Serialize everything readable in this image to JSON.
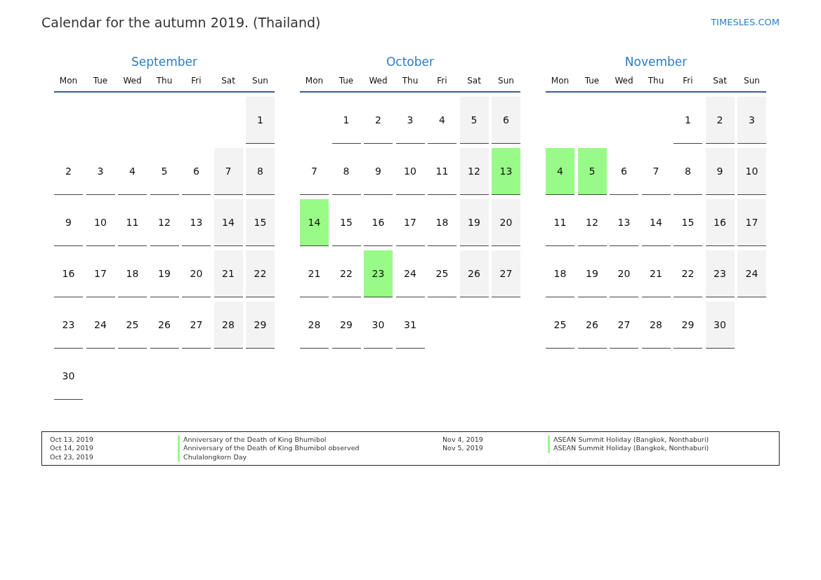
{
  "title": "Calendar for the autumn 2019. (Thailand)",
  "site": "TIMESLES.COM",
  "months": [
    {
      "name": "September",
      "weekdays": [
        "Mon",
        "Tue",
        "Wed",
        "Thu",
        "Fri",
        "Sat",
        "Sun"
      ],
      "weeks": [
        {
          "kind": "start",
          "days": [
            {
              "day": "1",
              "kind": "weekend"
            }
          ]
        },
        {
          "kind": "full",
          "days": [
            {
              "day": "2",
              "kind": "weekday"
            },
            {
              "day": "3",
              "kind": "weekday"
            },
            {
              "day": "4",
              "kind": "weekday"
            },
            {
              "day": "5",
              "kind": "weekday"
            },
            {
              "day": "6",
              "kind": "weekday"
            },
            {
              "day": "7",
              "kind": "weekend"
            },
            {
              "day": "8",
              "kind": "weekend"
            }
          ]
        },
        {
          "kind": "full",
          "days": [
            {
              "day": "9",
              "kind": "weekday"
            },
            {
              "day": "10",
              "kind": "weekday"
            },
            {
              "day": "11",
              "kind": "weekday"
            },
            {
              "day": "12",
              "kind": "weekday"
            },
            {
              "day": "13",
              "kind": "weekday"
            },
            {
              "day": "14",
              "kind": "weekend"
            },
            {
              "day": "15",
              "kind": "weekend"
            }
          ]
        },
        {
          "kind": "full",
          "days": [
            {
              "day": "16",
              "kind": "weekday"
            },
            {
              "day": "17",
              "kind": "weekday"
            },
            {
              "day": "18",
              "kind": "weekday"
            },
            {
              "day": "19",
              "kind": "weekday"
            },
            {
              "day": "20",
              "kind": "weekday"
            },
            {
              "day": "21",
              "kind": "weekend"
            },
            {
              "day": "22",
              "kind": "weekend"
            }
          ]
        },
        {
          "kind": "full",
          "days": [
            {
              "day": "23",
              "kind": "weekday"
            },
            {
              "day": "24",
              "kind": "weekday"
            },
            {
              "day": "25",
              "kind": "weekday"
            },
            {
              "day": "26",
              "kind": "weekday"
            },
            {
              "day": "27",
              "kind": "weekday"
            },
            {
              "day": "28",
              "kind": "weekend"
            },
            {
              "day": "29",
              "kind": "weekend"
            }
          ]
        },
        {
          "kind": "end",
          "days": [
            {
              "day": "30",
              "kind": "weekday"
            }
          ]
        }
      ]
    },
    {
      "name": "October",
      "weekdays": [
        "Mon",
        "Tue",
        "Wed",
        "Thu",
        "Fri",
        "Sat",
        "Sun"
      ],
      "weeks": [
        {
          "kind": "start",
          "days": [
            {
              "day": "1",
              "kind": "weekday"
            },
            {
              "day": "2",
              "kind": "weekday"
            },
            {
              "day": "3",
              "kind": "weekday"
            },
            {
              "day": "4",
              "kind": "weekday"
            },
            {
              "day": "5",
              "kind": "weekend"
            },
            {
              "day": "6",
              "kind": "weekend"
            }
          ]
        },
        {
          "kind": "full",
          "days": [
            {
              "day": "7",
              "kind": "weekday"
            },
            {
              "day": "8",
              "kind": "weekday"
            },
            {
              "day": "9",
              "kind": "weekday"
            },
            {
              "day": "10",
              "kind": "weekday"
            },
            {
              "day": "11",
              "kind": "weekday"
            },
            {
              "day": "12",
              "kind": "weekend"
            },
            {
              "day": "13",
              "kind": "holiday"
            }
          ]
        },
        {
          "kind": "full",
          "days": [
            {
              "day": "14",
              "kind": "holiday"
            },
            {
              "day": "15",
              "kind": "weekday"
            },
            {
              "day": "16",
              "kind": "weekday"
            },
            {
              "day": "17",
              "kind": "weekday"
            },
            {
              "day": "18",
              "kind": "weekday"
            },
            {
              "day": "19",
              "kind": "weekend"
            },
            {
              "day": "20",
              "kind": "weekend"
            }
          ]
        },
        {
          "kind": "full",
          "days": [
            {
              "day": "21",
              "kind": "weekday"
            },
            {
              "day": "22",
              "kind": "weekday"
            },
            {
              "day": "23",
              "kind": "holiday"
            },
            {
              "day": "24",
              "kind": "weekday"
            },
            {
              "day": "25",
              "kind": "weekday"
            },
            {
              "day": "26",
              "kind": "weekend"
            },
            {
              "day": "27",
              "kind": "weekend"
            }
          ]
        },
        {
          "kind": "end",
          "days": [
            {
              "day": "28",
              "kind": "weekday"
            },
            {
              "day": "29",
              "kind": "weekday"
            },
            {
              "day": "30",
              "kind": "weekday"
            },
            {
              "day": "31",
              "kind": "weekday"
            }
          ]
        }
      ]
    },
    {
      "name": "November",
      "weekdays": [
        "Mon",
        "Tue",
        "Wed",
        "Thu",
        "Fri",
        "Sat",
        "Sun"
      ],
      "weeks": [
        {
          "kind": "start",
          "days": [
            {
              "day": "1",
              "kind": "weekday"
            },
            {
              "day": "2",
              "kind": "weekend"
            },
            {
              "day": "3",
              "kind": "weekend"
            }
          ]
        },
        {
          "kind": "full",
          "days": [
            {
              "day": "4",
              "kind": "holiday"
            },
            {
              "day": "5",
              "kind": "holiday"
            },
            {
              "day": "6",
              "kind": "weekday"
            },
            {
              "day": "7",
              "kind": "weekday"
            },
            {
              "day": "8",
              "kind": "weekday"
            },
            {
              "day": "9",
              "kind": "weekend"
            },
            {
              "day": "10",
              "kind": "weekend"
            }
          ]
        },
        {
          "kind": "full",
          "days": [
            {
              "day": "11",
              "kind": "weekday"
            },
            {
              "day": "12",
              "kind": "weekday"
            },
            {
              "day": "13",
              "kind": "weekday"
            },
            {
              "day": "14",
              "kind": "weekday"
            },
            {
              "day": "15",
              "kind": "weekday"
            },
            {
              "day": "16",
              "kind": "weekend"
            },
            {
              "day": "17",
              "kind": "weekend"
            }
          ]
        },
        {
          "kind": "full",
          "days": [
            {
              "day": "18",
              "kind": "weekday"
            },
            {
              "day": "19",
              "kind": "weekday"
            },
            {
              "day": "20",
              "kind": "weekday"
            },
            {
              "day": "21",
              "kind": "weekday"
            },
            {
              "day": "22",
              "kind": "weekday"
            },
            {
              "day": "23",
              "kind": "weekend"
            },
            {
              "day": "24",
              "kind": "weekend"
            }
          ]
        },
        {
          "kind": "end",
          "days": [
            {
              "day": "25",
              "kind": "weekday"
            },
            {
              "day": "26",
              "kind": "weekday"
            },
            {
              "day": "27",
              "kind": "weekday"
            },
            {
              "day": "28",
              "kind": "weekday"
            },
            {
              "day": "29",
              "kind": "weekday"
            },
            {
              "day": "30",
              "kind": "weekend"
            }
          ]
        }
      ]
    }
  ],
  "legend": [
    [
      {
        "date": "Oct 13, 2019",
        "name": "Anniversary of the Death of King Bhumibol"
      },
      {
        "date": "Oct 14, 2019",
        "name": "Anniversary of the Death of King Bhumibol observed"
      },
      {
        "date": "Oct 23, 2019",
        "name": "Chulalongkorn Day"
      }
    ],
    [
      {
        "date": "Nov 4, 2019",
        "name": "ASEAN Summit Holiday (Bangkok, Nonthaburi)"
      },
      {
        "date": "Nov 5, 2019",
        "name": "ASEAN Summit Holiday (Bangkok, Nonthaburi)"
      }
    ]
  ]
}
